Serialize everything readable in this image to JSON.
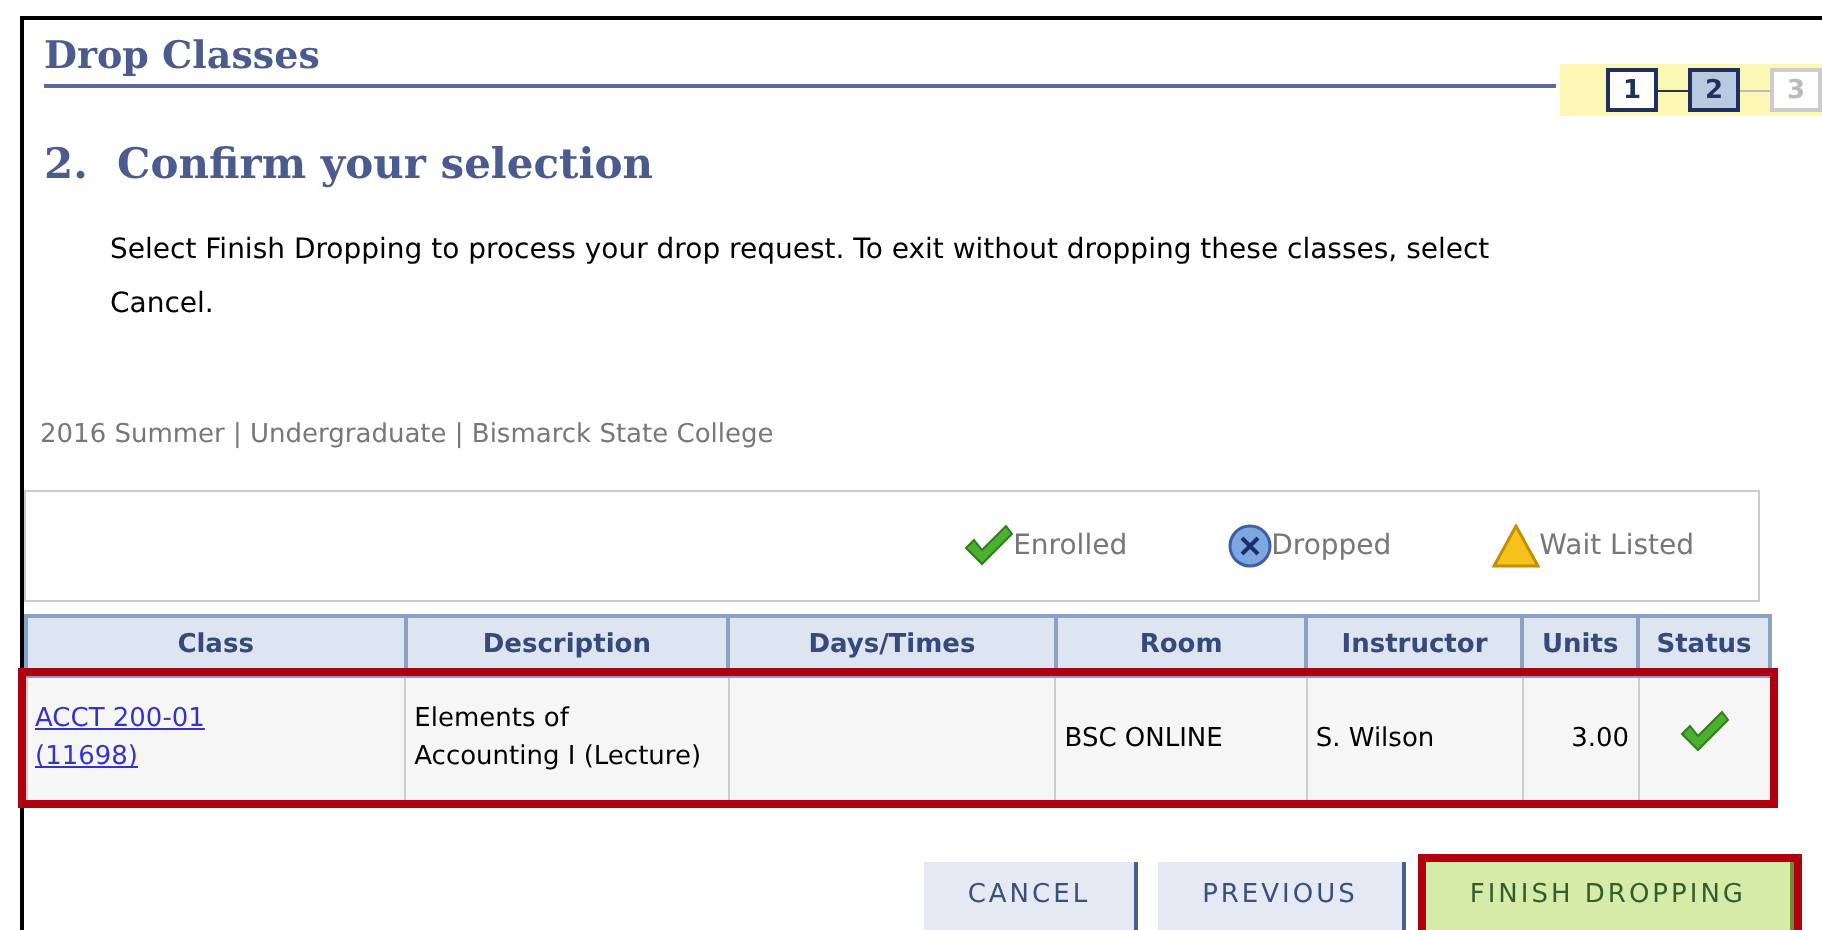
{
  "page_title": "Drop Classes",
  "steps": [
    {
      "label": "1",
      "selected": false,
      "disabled": false
    },
    {
      "label": "2",
      "selected": true,
      "disabled": false
    },
    {
      "label": "3",
      "selected": false,
      "disabled": true
    }
  ],
  "heading": "2.  Confirm your selection",
  "instructions": "Select Finish Dropping to process your drop request. To exit without dropping these classes, select Cancel.",
  "term": "2016 Summer | Undergraduate | Bismarck State College",
  "legend": [
    {
      "kind": "enrolled",
      "label": "Enrolled"
    },
    {
      "kind": "dropped",
      "label": "Dropped"
    },
    {
      "kind": "waitlisted",
      "label": "Wait Listed"
    }
  ],
  "table": {
    "columns": [
      "Class",
      "Description",
      "Days/Times",
      "Room",
      "Instructor",
      "Units",
      "Status"
    ],
    "rows": [
      {
        "class": "ACCT 200-01 (11698)",
        "description": "Elements of Accounting I (Lecture)",
        "room": "BSC ONLINE",
        "instructor": "S. Wilson",
        "units": "3.00",
        "enrolled": true,
        "highlighted": true
      }
    ]
  },
  "buttons": [
    {
      "label": "CANCEL",
      "kind": "plain",
      "highlighted": false
    },
    {
      "label": "PREVIOUS",
      "kind": "plain",
      "highlighted": false
    },
    {
      "label": "FINISH DROPPING",
      "kind": "primary",
      "highlighted": true
    }
  ]
}
